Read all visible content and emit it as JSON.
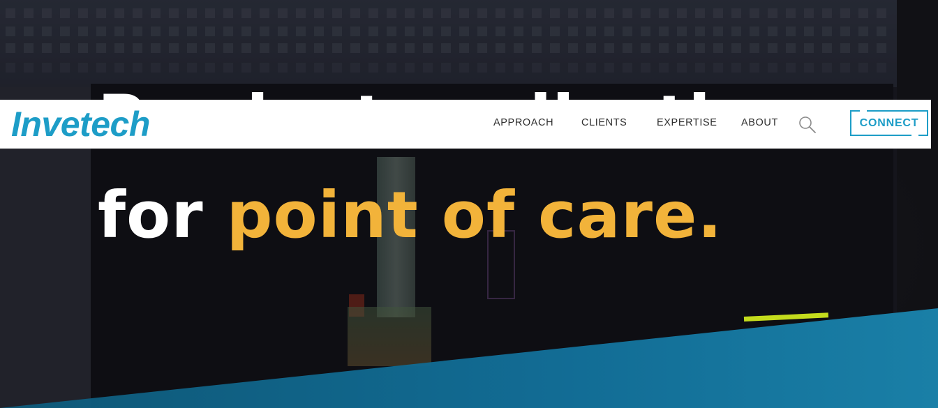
{
  "colors": {
    "brand": "#1d9dc7",
    "accent_gold": "#f2b33a",
    "accent_lime": "#c4dc1d",
    "band_blue": "#12709a"
  },
  "header": {
    "logo_text": "Invetech",
    "nav": [
      {
        "label": "APPROACH"
      },
      {
        "label": "CLIENTS"
      },
      {
        "label": "EXPERTISE"
      },
      {
        "label": "ABOUT"
      }
    ],
    "search_icon": "search-icon",
    "connect_label": "CONNECT"
  },
  "hero": {
    "line1": "Product realization",
    "line2_white": "for ",
    "line2_gold": "point of care."
  }
}
